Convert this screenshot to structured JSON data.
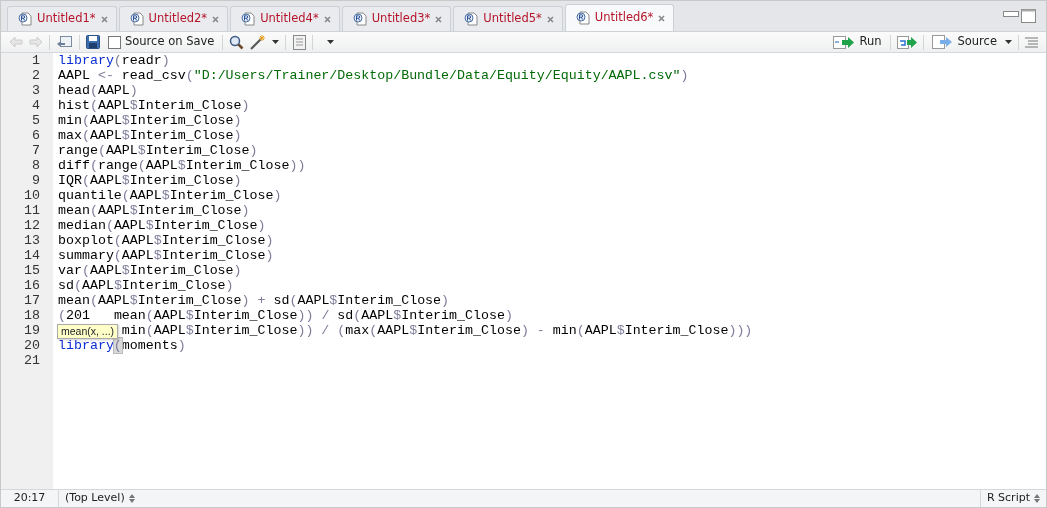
{
  "tabs": [
    {
      "label": "Untitled1*",
      "selected": false
    },
    {
      "label": "Untitled2*",
      "selected": false
    },
    {
      "label": "Untitled4*",
      "selected": false
    },
    {
      "label": "Untitled3*",
      "selected": false
    },
    {
      "label": "Untitled5*",
      "selected": false
    },
    {
      "label": "Untitled6*",
      "selected": true
    }
  ],
  "toolbar": {
    "source_on_save": {
      "label": "Source on Save",
      "checked": false
    },
    "run": "Run",
    "source": "Source"
  },
  "lines": [
    {
      "number": "1",
      "segments": [
        "library(readr)"
      ],
      "keyword_lead": true
    },
    {
      "number": "2",
      "segments": [
        "AAPL <- read_csv(\"D:/Users/Trainer/Desktop/Bundle/Data/Equity/Equity/AAPL.csv\")"
      ]
    },
    {
      "number": "3",
      "segments": [
        "head(AAPL)"
      ]
    },
    {
      "number": "4",
      "segments": [
        "hist(AAPL$Interim_Close)"
      ]
    },
    {
      "number": "5",
      "segments": [
        "min(AAPL$Interim_Close)"
      ]
    },
    {
      "number": "6",
      "segments": [
        "max(AAPL$Interim_Close)"
      ]
    },
    {
      "number": "7",
      "segments": [
        "range(AAPL$Interim_Close)"
      ]
    },
    {
      "number": "8",
      "segments": [
        "diff(range(AAPL$Interim_Close))"
      ]
    },
    {
      "number": "9",
      "segments": [
        "IQR(AAPL$Interim_Close)"
      ]
    },
    {
      "number": "10",
      "segments": [
        "quantile(AAPL$Interim_Close)"
      ]
    },
    {
      "number": "11",
      "segments": [
        "mean(AAPL$Interim_Close)"
      ]
    },
    {
      "number": "12",
      "segments": [
        "median(AAPL$Interim_Close)"
      ]
    },
    {
      "number": "13",
      "segments": [
        "boxplot(AAPL$Interim_Close)"
      ]
    },
    {
      "number": "14",
      "segments": [
        "summary(AAPL$Interim_Close)"
      ]
    },
    {
      "number": "15",
      "segments": [
        "var(AAPL$Interim_Close)"
      ]
    },
    {
      "number": "16",
      "segments": [
        "sd(AAPL$Interim_Close)"
      ]
    },
    {
      "number": "17",
      "segments": [
        "mean(AAPL$Interim_Close) + sd(AAPL$Interim_Close)"
      ]
    },
    {
      "number": "18",
      "segments": [
        "(201",
        "mean(AAPL$Interim_Close)) / sd(AAPL$Interim_Close)"
      ]
    },
    {
      "number": "19",
      "segments": [
        "min(AAPL$Interim_Close)) / (max(AAPL$Interim_Close) - min(AAPL$Interim_Close)))"
      ],
      "starts_covered": true
    },
    {
      "number": "20",
      "segments": [
        "library(moments)"
      ],
      "keyword_lead": true,
      "bracket_match": true
    },
    {
      "number": "21"
    }
  ],
  "tooltip": "mean(x, ...)",
  "status_bar": {
    "position": "20:17",
    "scope": "(Top Level)",
    "file_type": "R Script"
  }
}
